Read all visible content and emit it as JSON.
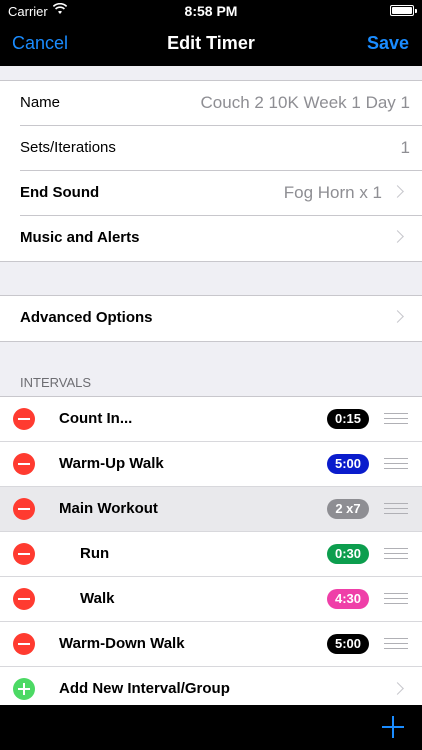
{
  "status_bar": {
    "carrier": "Carrier",
    "time": "8:58 PM",
    "battery_level": 1.0
  },
  "nav": {
    "cancel_label": "Cancel",
    "title": "Edit Timer",
    "save_label": "Save"
  },
  "settings": {
    "name_label": "Name",
    "name_value": "Couch 2 10K Week 1 Day 1",
    "sets_label": "Sets/Iterations",
    "sets_value": "1",
    "end_sound_label": "End Sound",
    "end_sound_value": "Fog Horn x 1",
    "music_label": "Music and Alerts"
  },
  "advanced": {
    "label": "Advanced Options"
  },
  "intervals": {
    "header": "INTERVALS",
    "items": [
      {
        "label": "Count In...",
        "badge": "0:15",
        "color": "#000000"
      },
      {
        "label": "Warm-Up Walk",
        "badge": "5:00",
        "color": "#0a1ccc"
      },
      {
        "label": "Main Workout",
        "badge": "2 x7",
        "color": "#8e8e93"
      },
      {
        "label": "Run",
        "badge": "0:30",
        "color": "#0c9e4e"
      },
      {
        "label": "Walk",
        "badge": "4:30",
        "color": "#ef3fa8"
      },
      {
        "label": "Warm-Down Walk",
        "badge": "5:00",
        "color": "#000000"
      }
    ],
    "add_label": "Add New Interval/Group"
  },
  "colors": {
    "accent": "#1a8cff",
    "delete": "#ff3b30",
    "add": "#4cd964"
  }
}
